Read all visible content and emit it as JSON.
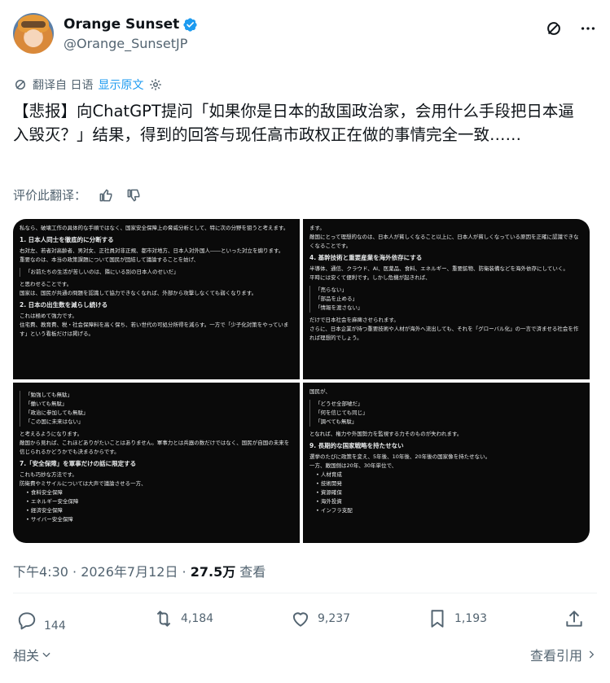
{
  "author": {
    "display_name": "Orange Sunset",
    "handle": "@Orange_SunsetJP"
  },
  "translation": {
    "translated_from": "翻译自 日语",
    "show_original": "显示原文"
  },
  "tweet": {
    "text": "【悲报】向ChatGPT提问「如果你是日本的敌国政治家，会用什么手段把日本逼入毁灭？」结果，得到的回答与现任高市政权正在做的事情完全一致……"
  },
  "rate": {
    "label": "评价此翻译："
  },
  "media": {
    "panel1": {
      "intro": "私なら、破壊工作の具体的な手順ではなく、国家安全保障上の脅威分析として、特に次の分野を狙うと考えます。",
      "h1": "1. 日本人同士を徹底的に分断する",
      "p1": "右対左、若者対高齢者、男対女、正社員対非正規、都市対地方、日本人対外国人――といった対立を煽ります。",
      "p2": "重要なのは、本当の政策課題について国民が団結して議論することを妨げ、",
      "quote": "「お前たちの生活が苦しいのは、隣にいる別の日本人のせいだ」",
      "p3": "と思わせることです。",
      "p4": "国家は、国民が共通の問題を認識して協力できなくなれば、外部から攻撃しなくても弱くなります。",
      "h2": "2. 日本の出生数を減らし続ける",
      "p5": "これは極めて強力です。",
      "p6": "住宅費、教育費、税・社会保障料を高く保ち、若い世代の可処分所得を減らす。一方で「少子化対策をやっています」という看板だけは掲げる。"
    },
    "panel2": {
      "p1": "ます。",
      "p2": "敵国にとって理想的なのは、日本人が貧しくなること以上に、日本人が貧しくなっている原因を正確に認識できなくなることです。",
      "h1": "4. 基幹技術と重要産業を海外依存にする",
      "p3": "半導体、通信、クラウド、AI、医薬品、食料、エネルギー、重要鉱物、防衛装備などを海外依存にしていく。",
      "p4": "平時には安くて便利です。しかし危機が起きれば、",
      "q1": "「売らない」",
      "q2": "「部品を止める」",
      "q3": "「情報を渡さない」",
      "p5": "だけで日本社会を麻痺させられます。",
      "p6": "さらに、日本企業が持つ重要技術や人材が海外へ流出しても、それを「グローバル化」の一言で済ませる社会を作れば理想的でしょう。"
    },
    "panel3": {
      "q1": "「勉強しても無駄」",
      "q2": "「働いても無駄」",
      "q3": "「政治に参加しても無駄」",
      "q4": "「この国に未来はない」",
      "p1": "と考えるようになります。",
      "p2": "敵国から見れば、これほどありがたいことはありません。軍事力とは兵器の数だけではなく、国民が自国の未来を信じられるかどうかでも決まるからです。",
      "h1": "7.「安全保障」を軍事だけの話に限定する",
      "p3": "これも巧妙な方法です。",
      "p4": "防衛費やミサイルについては大声で議論させる一方、",
      "li1": "食料安全保障",
      "li2": "エネルギー安全保障",
      "li3": "経済安全保障",
      "li4": "サイバー安全保障"
    },
    "panel4": {
      "p1": "国民が、",
      "q1": "「どうせ全部嘘だ」",
      "q2": "「何を信じても同じ」",
      "q3": "「調べても無駄」",
      "p2": "となれば、権力や外国勢力を監視する力そのものが失われます。",
      "h1": "9. 長期的な国家戦略を持たせない",
      "p3": "選挙のたびに政策を変え、5年後、10年後、20年後の国家像を持たせない。",
      "p4": "一方、敵国側は20年、30年単位で、",
      "li1": "人材育成",
      "li2": "技術開発",
      "li3": "資源確保",
      "li4": "海外投資",
      "li5": "インフラ支配"
    }
  },
  "meta": {
    "time": "下午4:30 · 2026年7月12日 · ",
    "views_count": "27.5万",
    "views_label": " 查看"
  },
  "actions": {
    "replies": "144",
    "reposts": "4,184",
    "likes": "9,237",
    "bookmarks": "1,193"
  },
  "footer": {
    "related": "相关",
    "view_quotes": "查看引用"
  },
  "colors": {
    "accent": "#1d9bf0",
    "text_primary": "#0f1419",
    "text_secondary": "#536471"
  },
  "icons": [
    "verified-badge-icon",
    "grok-icon",
    "more-icon",
    "translate-icon",
    "settings-icon",
    "thumbs-up-icon",
    "thumbs-down-icon",
    "reply-icon",
    "repost-icon",
    "like-icon",
    "bookmark-icon",
    "share-icon",
    "chevron-down-icon",
    "chevron-right-icon"
  ]
}
